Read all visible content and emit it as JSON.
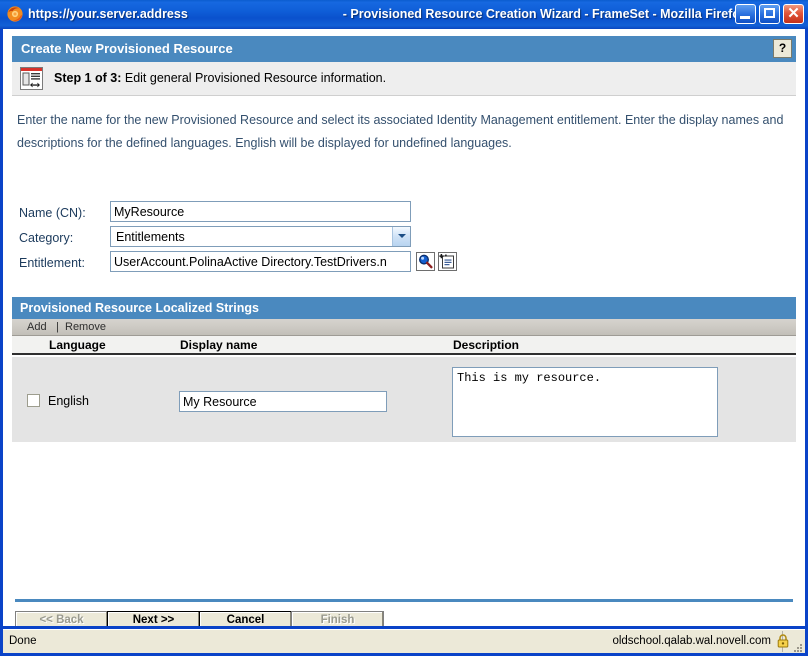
{
  "window": {
    "title": "https://your.server.address    - Provisioned Resource Creation Wizard - FrameSet - Mozilla Firefox",
    "title_url": "https://your.server.address",
    "title_rest": "- Provisioned Resource Creation Wizard - FrameSet - Mozilla Firefox",
    "minimize_label": "Minimize",
    "maximize_label": "Maximize",
    "close_label": "Close"
  },
  "wizard": {
    "header_title": "Create New Provisioned Resource",
    "help_label": "?",
    "step_prefix": "Step 1 of 3:",
    "step_text": "Edit general Provisioned Resource information.",
    "instructions": "Enter the name for the new Provisioned Resource and select its associated Identity Management entitlement.  Enter the display names and descriptions for the defined languages.  English will be displayed for undefined languages."
  },
  "form": {
    "name_label": "Name (CN):",
    "name_value": "MyResource",
    "category_label": "Category:",
    "category_value": "Entitlements",
    "category_options": [
      "Entitlements"
    ],
    "entitlement_label": "Entitlement:",
    "entitlement_value": "UserAccount.PolinaActive Directory.TestDrivers.n",
    "search_icon": "magnifier-icon",
    "new_object_icon": "new-object-icon"
  },
  "localized_panel": {
    "title": "Provisioned Resource Localized Strings",
    "toolbar": {
      "add_label": "Add",
      "separator": "|",
      "remove_label": "Remove"
    },
    "columns": [
      "Language",
      "Display name",
      "Description"
    ],
    "rows": [
      {
        "selected": false,
        "language": "English",
        "display_name": "My Resource",
        "description": "This is my resource."
      }
    ]
  },
  "buttons": {
    "back": {
      "label": "<< Back",
      "enabled": false
    },
    "next": {
      "label": "Next >>",
      "enabled": true
    },
    "cancel": {
      "label": "Cancel",
      "enabled": true
    },
    "finish": {
      "label": "Finish",
      "enabled": false
    }
  },
  "statusbar": {
    "status_text": "Done",
    "host": "oldschool.qalab.wal.novell.com",
    "lock_icon": "padlock-icon"
  },
  "colors": {
    "titlebar_blue": "#0f5ed8",
    "panel_header_blue": "#4a89bf",
    "window_border": "#0a43c8",
    "row_gray": "#e4e4e4",
    "instruction_text": "#34506e"
  }
}
